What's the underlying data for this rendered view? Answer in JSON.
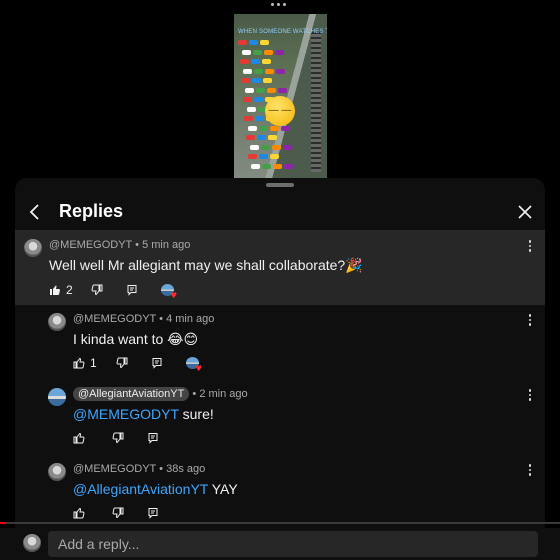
{
  "video": {
    "caption": "WHEN SOMEONE WATCHES THIS"
  },
  "panel": {
    "title": "Replies",
    "back_icon": "chevron-left-icon",
    "close_icon": "close-icon"
  },
  "comments": [
    {
      "author": "@MEMEGODYT",
      "time": "5 min ago",
      "text": "Well well Mr allegiant may we shall collaborate?🎉",
      "likes": "2",
      "creator_hearted": true
    },
    {
      "author": "@MEMEGODYT",
      "time": "4 min ago",
      "text": "I kinda want to 😂😊",
      "likes": "1",
      "creator_hearted": true
    },
    {
      "author": "@AllegiantAviationYT",
      "time": "2 min ago",
      "mention": "@MEMEGODYT",
      "text": " sure!",
      "likes": "",
      "author_is_creator": true
    },
    {
      "author": "@MEMEGODYT",
      "time": "38s ago",
      "mention": "@AllegiantAviationYT",
      "text": " YAY",
      "likes": ""
    }
  ],
  "reply_bar": {
    "placeholder": "Add a reply..."
  },
  "colors": {
    "background": "#0f0f0f",
    "highlight": "#272727",
    "mention": "#3ea6ff",
    "progress": "#ff0000"
  },
  "video_progress": 0.01
}
